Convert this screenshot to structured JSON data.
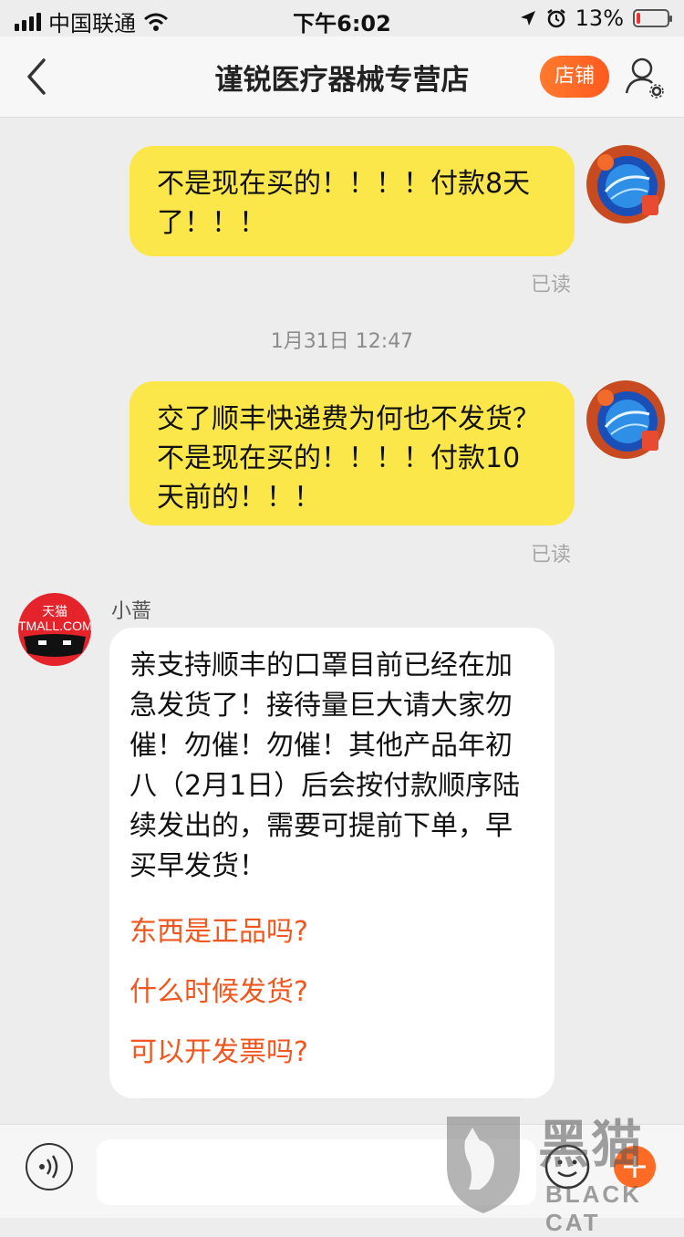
{
  "status_bar": {
    "carrier": "中国联通",
    "time": "下午6:02",
    "battery": "13%",
    "battery_level": 0.13
  },
  "header": {
    "title": "谨锐医疗器械专营店",
    "shop_button": "店铺"
  },
  "messages": [
    {
      "side": "right",
      "text": "不是现在买的！！！！付款8天了！！！",
      "status": "已读"
    },
    {
      "type": "time",
      "text": "1月31日 12:47"
    },
    {
      "side": "right",
      "text": "交了顺丰快递费为何也不发货？不是现在买的！！！！付款10天前的！！！",
      "status": "已读"
    },
    {
      "side": "left",
      "sender": "小蔷",
      "avatar_text": [
        "天猫",
        "TMALL.COM"
      ],
      "text": "亲支持顺丰的口罩目前已经在加急发货了！接待量巨大请大家勿催！勿催！勿催！其他产品年初八（2月1日）后会按付款顺序陆续发出的，需要可提前下单，早买早发货！",
      "quick_questions": [
        "东西是正品吗?",
        "什么时候发货?",
        "可以开发票吗?"
      ]
    }
  ],
  "input_bar": {
    "placeholder": ""
  },
  "watermark": {
    "text": "黑猫",
    "text_en": "BLACK CAT"
  },
  "colors": {
    "bubble_self": "#fce74b",
    "link": "#f0561e",
    "shop_button": "#ff6a25",
    "tmall_red": "#e5232b"
  },
  "icons": [
    "back-icon",
    "profile-settings-icon",
    "voice-icon",
    "emoji-icon",
    "plus-icon"
  ]
}
